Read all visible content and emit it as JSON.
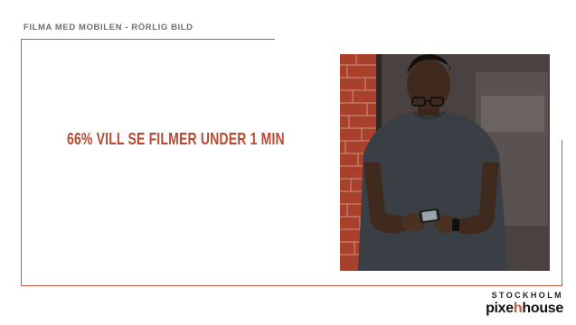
{
  "header": {
    "title": "FILMA MED MOBILEN - RÖRLIG BILD"
  },
  "main": {
    "headline": "66% VILL SE FILMER UNDER 1 MIN"
  },
  "logo": {
    "top": "STOCKHOLM",
    "brand_part1": "pixe",
    "brand_part2": "house",
    "accent_glyph": "h"
  },
  "colors": {
    "accent": "#c25a3a",
    "headline": "#b94a33",
    "header_text": "#6f6f6f"
  }
}
